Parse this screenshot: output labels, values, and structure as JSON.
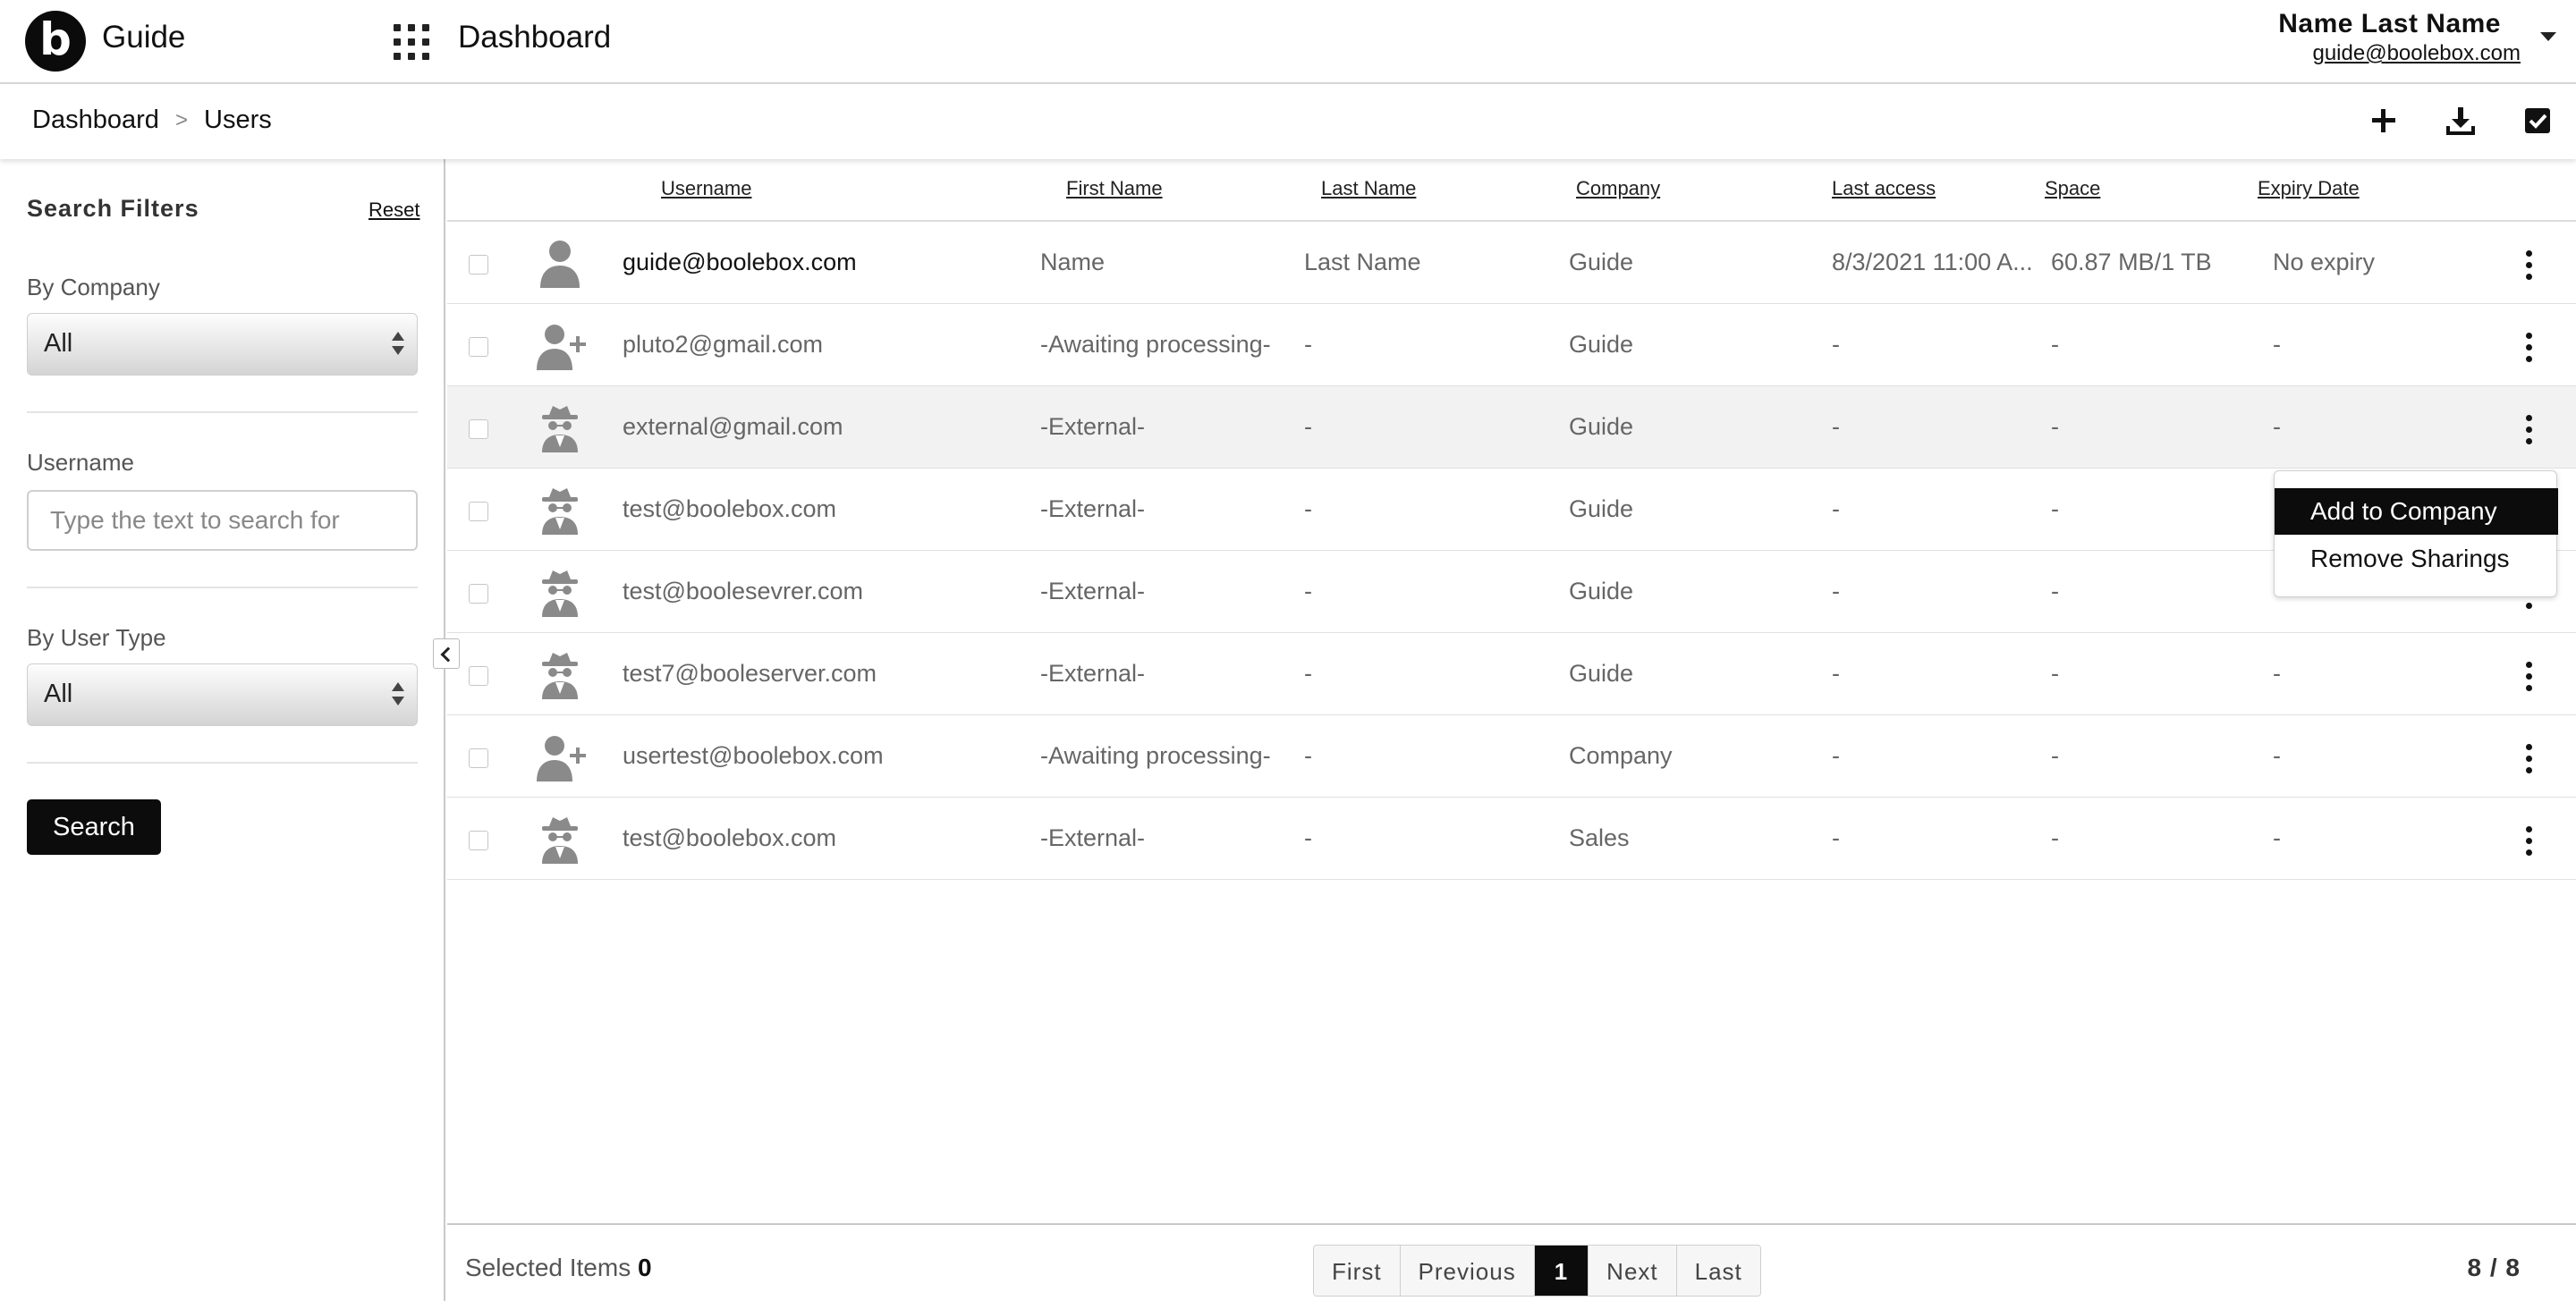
{
  "app": {
    "logo_letter": "b",
    "title": "Guide",
    "page_title": "Dashboard"
  },
  "user": {
    "name": "Name Last Name",
    "email": "guide@boolebox.com"
  },
  "breadcrumb": {
    "items": [
      "Dashboard",
      "Users"
    ],
    "separator": ">"
  },
  "toolbar": {
    "add_icon": "plus-icon",
    "download_icon": "download-icon",
    "select_icon": "check-square-icon"
  },
  "filters": {
    "title": "Search Filters",
    "reset": "Reset",
    "company_label": "By Company",
    "company_value": "All",
    "username_label": "Username",
    "username_placeholder": "Type the text to search for",
    "usertype_label": "By User Type",
    "usertype_value": "All",
    "search_button": "Search"
  },
  "table": {
    "columns": [
      "Username",
      "First Name",
      "Last Name",
      "Company",
      "Last access",
      "Space",
      "Expiry Date"
    ],
    "rows": [
      {
        "icon": "user-icon",
        "username": "guide@boolebox.com",
        "first": "Name",
        "last": "Last Name",
        "company": "Guide",
        "access": "8/3/2021 11:00 A...",
        "space": "60.87 MB/1 TB",
        "expiry": "No expiry"
      },
      {
        "icon": "user-add-icon",
        "username": "pluto2@gmail.com",
        "first": "-Awaiting processing-",
        "last": "-",
        "company": "Guide",
        "access": "-",
        "space": "-",
        "expiry": "-"
      },
      {
        "icon": "spy-icon",
        "username": "external@gmail.com",
        "first": "-External-",
        "last": "-",
        "company": "Guide",
        "access": "-",
        "space": "-",
        "expiry": "-"
      },
      {
        "icon": "spy-icon",
        "username": "test@boolebox.com",
        "first": "-External-",
        "last": "-",
        "company": "Guide",
        "access": "-",
        "space": "-",
        "expiry": ""
      },
      {
        "icon": "spy-icon",
        "username": "test@boolesevrer.com",
        "first": "-External-",
        "last": "-",
        "company": "Guide",
        "access": "-",
        "space": "-",
        "expiry": ""
      },
      {
        "icon": "spy-icon",
        "username": "test7@booleserver.com",
        "first": "-External-",
        "last": "-",
        "company": "Guide",
        "access": "-",
        "space": "-",
        "expiry": "-"
      },
      {
        "icon": "user-add-icon",
        "username": "usertest@boolebox.com",
        "first": "-Awaiting processing-",
        "last": "-",
        "company": "Company",
        "access": "-",
        "space": "-",
        "expiry": "-"
      },
      {
        "icon": "spy-icon",
        "username": "test@boolebox.com",
        "first": "-External-",
        "last": "-",
        "company": "Sales",
        "access": "-",
        "space": "-",
        "expiry": "-"
      }
    ]
  },
  "context_menu": {
    "items": [
      "Add to Company",
      "Remove Sharings"
    ]
  },
  "footer": {
    "selected_label": "Selected Items",
    "selected_count": "0",
    "pager": [
      "First",
      "Previous",
      "1",
      "Next",
      "Last"
    ],
    "count": "8 / 8"
  }
}
